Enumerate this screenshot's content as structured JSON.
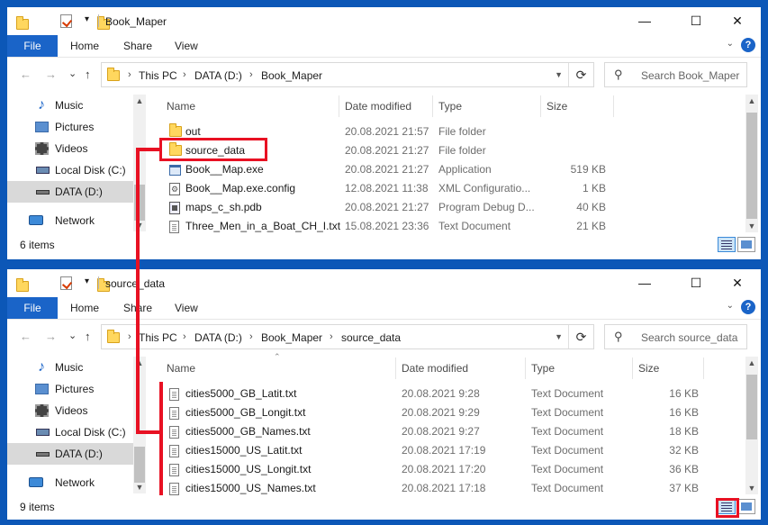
{
  "ribbon": {
    "file": "File",
    "home": "Home",
    "share": "Share",
    "view": "View"
  },
  "nav": {
    "back": "←",
    "forward": "→",
    "dropdown": "⌄",
    "up": "↑",
    "refresh": "⟳",
    "items": [
      {
        "icon": "music-icon",
        "label": "Music"
      },
      {
        "icon": "pictures-icon",
        "label": "Pictures"
      },
      {
        "icon": "videos-icon",
        "label": "Videos"
      },
      {
        "icon": "local-disk-icon",
        "label": "Local Disk (C:)"
      },
      {
        "icon": "drive-icon",
        "label": "DATA (D:)"
      }
    ],
    "network": "Network"
  },
  "columns": {
    "name": "Name",
    "date": "Date modified",
    "type": "Type",
    "size": "Size"
  },
  "window1": {
    "title": "Book_Maper",
    "breadcrumb": [
      "This PC",
      "DATA (D:)",
      "Book_Maper"
    ],
    "search_placeholder": "Search Book_Maper",
    "status": "6 items",
    "files": [
      {
        "icon": "folder-icon",
        "name": "out",
        "date": "20.08.2021 21:57",
        "type": "File folder",
        "size": ""
      },
      {
        "icon": "folder-icon",
        "name": "source_data",
        "date": "20.08.2021 21:27",
        "type": "File folder",
        "size": ""
      },
      {
        "icon": "application-icon",
        "name": "Book__Map.exe",
        "date": "20.08.2021 21:27",
        "type": "Application",
        "size": "519 KB"
      },
      {
        "icon": "config-file-icon",
        "name": "Book__Map.exe.config",
        "date": "12.08.2021 11:38",
        "type": "XML Configuratio...",
        "size": "1 KB"
      },
      {
        "icon": "pdb-file-icon",
        "name": "maps_c_sh.pdb",
        "date": "20.08.2021 21:27",
        "type": "Program Debug D...",
        "size": "40 KB"
      },
      {
        "icon": "text-file-icon",
        "name": "Three_Men_in_a_Boat_CH_I.txt",
        "date": "15.08.2021 23:36",
        "type": "Text Document",
        "size": "21 KB"
      }
    ]
  },
  "window2": {
    "title": "source_data",
    "breadcrumb": [
      "This PC",
      "DATA (D:)",
      "Book_Maper",
      "source_data"
    ],
    "search_placeholder": "Search source_data",
    "status": "9 items",
    "files": [
      {
        "icon": "text-file-icon",
        "name": "cities5000_GB_Latit.txt",
        "date": "20.08.2021 9:28",
        "type": "Text Document",
        "size": "16 KB"
      },
      {
        "icon": "text-file-icon",
        "name": "cities5000_GB_Longit.txt",
        "date": "20.08.2021 9:29",
        "type": "Text Document",
        "size": "16 KB"
      },
      {
        "icon": "text-file-icon",
        "name": "cities5000_GB_Names.txt",
        "date": "20.08.2021 9:27",
        "type": "Text Document",
        "size": "18 KB"
      },
      {
        "icon": "text-file-icon",
        "name": "cities15000_US_Latit.txt",
        "date": "20.08.2021 17:19",
        "type": "Text Document",
        "size": "32 KB"
      },
      {
        "icon": "text-file-icon",
        "name": "cities15000_US_Longit.txt",
        "date": "20.08.2021 17:20",
        "type": "Text Document",
        "size": "36 KB"
      },
      {
        "icon": "text-file-icon",
        "name": "cities15000_US_Names.txt",
        "date": "20.08.2021 17:18",
        "type": "Text Document",
        "size": "37 KB"
      }
    ]
  },
  "colors": {
    "desktop": "#0c57b7",
    "accent": "#1a64c8",
    "highlight": "#e81123"
  }
}
